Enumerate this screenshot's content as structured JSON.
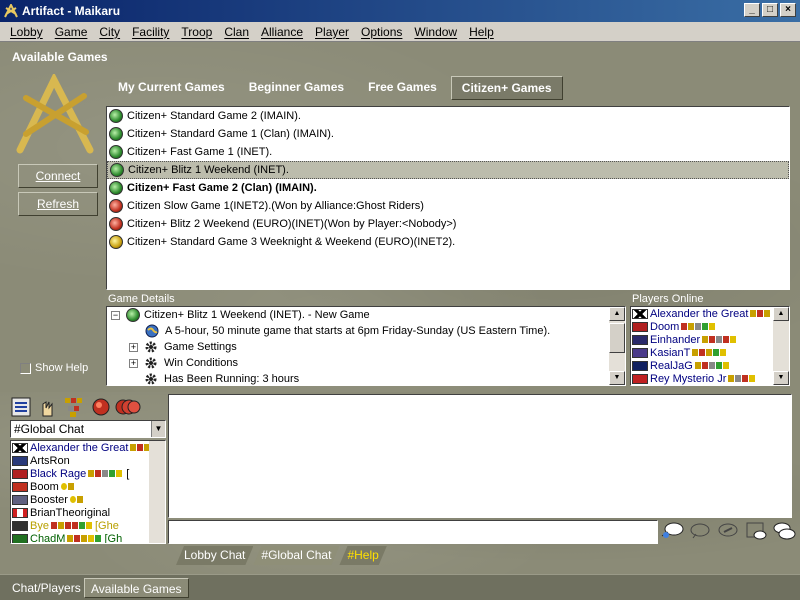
{
  "window": {
    "title": "Artifact - Maikaru"
  },
  "menu": [
    "Lobby",
    "Game",
    "City",
    "Facility",
    "Troop",
    "Clan",
    "Alliance",
    "Player",
    "Options",
    "Window",
    "Help"
  ],
  "section_title": "Available Games",
  "tabs": [
    "My Current Games",
    "Beginner Games",
    "Free Games",
    "Citizen+ Games"
  ],
  "active_tab": "Citizen+ Games",
  "buttons": {
    "connect": "Connect",
    "refresh": "Refresh"
  },
  "games": [
    {
      "name": "Citizen+ Standard Game 2 (IMAIN).",
      "icon": "green-globe-icon"
    },
    {
      "name": "Citizen+ Standard Game 1 (Clan) (IMAIN).",
      "icon": "green-globe-icon"
    },
    {
      "name": "Citizen+ Fast Game 1 (INET).",
      "icon": "green-globe-icon"
    },
    {
      "name": "Citizen+ Blitz 1 Weekend (INET).",
      "icon": "green-globe-icon"
    },
    {
      "name": "Citizen+ Fast Game 2 (Clan) (IMAIN).",
      "icon": "green-globe-icon"
    },
    {
      "name": "Citizen Slow Game 1(INET2).(Won by Alliance:Ghost Riders)",
      "icon": "red-globe-icon"
    },
    {
      "name": "Citizen+ Blitz 2 Weekend (EURO)(INET)(Won by Player:<Nobody>)",
      "icon": "red-globe-icon"
    },
    {
      "name": "Citizen+ Standard Game 3 Weeknight & Weekend (EURO)(INET2).",
      "icon": "yellow-globe-icon"
    }
  ],
  "selected_game_index": 3,
  "bold_game_index": 4,
  "game_details": {
    "label": "Game Details",
    "root": "Citizen+ Blitz 1 Weekend (INET). - New Game",
    "description": "A 5-hour, 50 minute game that starts at 6pm Friday-Sunday (US Eastern Time).",
    "game_settings": "Game Settings",
    "win_conditions": "Win Conditions",
    "running": "Has Been Running:  3 hours"
  },
  "players_online": {
    "label": "Players Online",
    "players": [
      "Alexander the Great",
      "Doom",
      "Einhander",
      "KasianT",
      "RealJaG",
      "Rey Mysterio Jr"
    ]
  },
  "show_help": "Show Help",
  "chat": {
    "channel": "#Global Chat",
    "users": [
      {
        "name": "Alexander the Great",
        "color": "#000080"
      },
      {
        "name": "ArtsRon",
        "color": "#000000"
      },
      {
        "name": "Black Rage",
        "color": "#000080"
      },
      {
        "name": "Boom",
        "color": "#000000"
      },
      {
        "name": "Booster",
        "color": "#000000"
      },
      {
        "name": "BrianTheoriginal",
        "color": "#000000"
      },
      {
        "name": "Bye",
        "color": "#b8a000"
      },
      {
        "name": "ChadM",
        "color": "#006000"
      }
    ],
    "user_suffix_1": "[",
    "user_suffix_2": "[Ghe",
    "user_suffix_3": "[Gh",
    "tabs": [
      "Lobby Chat",
      "#Global Chat",
      "#Help"
    ]
  },
  "status_tabs": [
    "Chat/Players",
    "Available Games"
  ],
  "colors": {
    "marble": "#8b8b77",
    "title_start": "#0a246a",
    "title_end": "#3a6ea5",
    "help_tab_text": "#ffe000"
  }
}
